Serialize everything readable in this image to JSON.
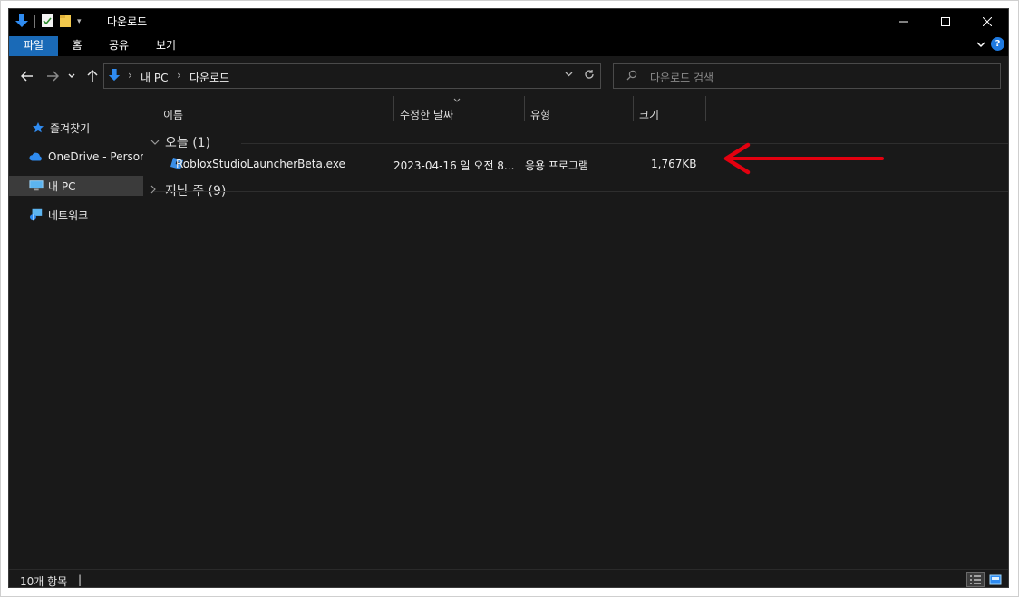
{
  "window": {
    "title": "다운로드"
  },
  "ribbon": {
    "tabs": [
      "파일",
      "홈",
      "공유",
      "보기"
    ],
    "help_label": "?"
  },
  "address": {
    "path": [
      "내 PC",
      "다운로드"
    ],
    "search_placeholder": "다운로드 검색"
  },
  "navpane": {
    "items": [
      {
        "label": "즐겨찾기",
        "icon": "star-icon"
      },
      {
        "label": "OneDrive - Persona",
        "icon": "onedrive-icon"
      },
      {
        "label": "내 PC",
        "icon": "this-pc-icon",
        "selected": true
      },
      {
        "label": "네트워크",
        "icon": "network-icon"
      }
    ]
  },
  "columns": [
    "이름",
    "수정한 날짜",
    "유형",
    "크기"
  ],
  "groups": [
    {
      "label": "오늘 (1)",
      "expanded": true,
      "files": [
        {
          "name": "RobloxStudioLauncherBeta.exe",
          "modified": "2023-04-16 일 오전 8...",
          "type": "응용 프로그램",
          "size": "1,767KB",
          "icon": "roblox-app-icon"
        }
      ]
    },
    {
      "label": "지난 주 (9)",
      "expanded": false,
      "files": []
    }
  ],
  "status": {
    "item_count": "10개 항목"
  },
  "colors": {
    "background": "#191919",
    "selected_nav": "#3b3b3b",
    "file_tab": "#1a6ab7",
    "annotation_arrow": "#e3000f",
    "download_blue": "#2f8bf0"
  }
}
